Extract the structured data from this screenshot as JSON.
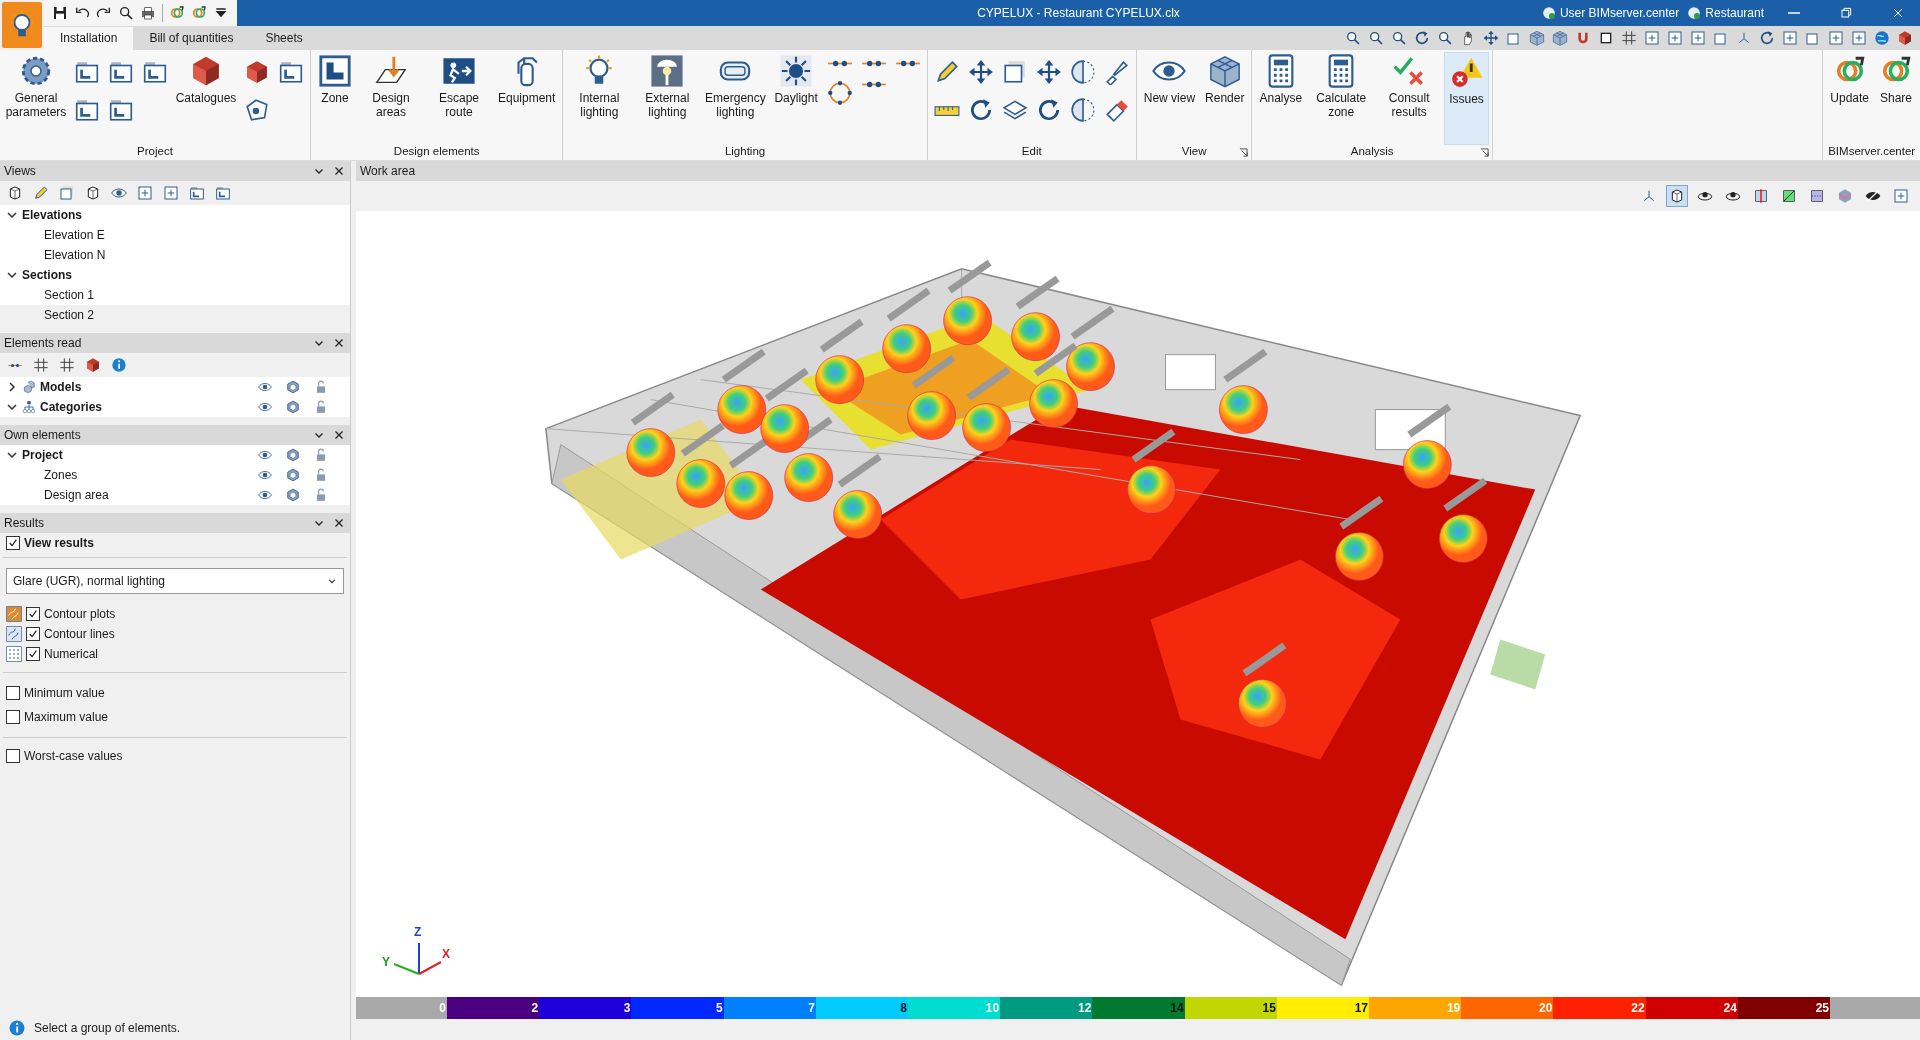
{
  "window": {
    "title": "CYPELUX - Restaurant CYPELUX.clx",
    "user": "User BIMserver.center",
    "project": "Restaurant"
  },
  "tabs": [
    {
      "label": "Installation",
      "selected": true
    },
    {
      "label": "Bill of quantities",
      "selected": false
    },
    {
      "label": "Sheets",
      "selected": false
    }
  ],
  "ribbon": [
    {
      "label": "Project",
      "dialog_launcher": false,
      "items": [
        {
          "kind": "large",
          "label": "General parameters",
          "highlighted": false
        },
        {
          "kind": "stack"
        },
        {
          "kind": "stack"
        },
        {
          "kind": "stack"
        },
        {
          "kind": "large",
          "label": "Catalogues",
          "highlighted": false
        },
        {
          "kind": "stack"
        },
        {
          "kind": "stack"
        }
      ]
    },
    {
      "label": "Design elements",
      "dialog_launcher": false,
      "items": [
        {
          "kind": "large",
          "label": "Zone",
          "highlighted": false
        },
        {
          "kind": "large",
          "label": "Design areas",
          "highlighted": false
        },
        {
          "kind": "large",
          "label": "Escape route",
          "highlighted": false
        },
        {
          "kind": "large",
          "label": "Equipment",
          "highlighted": false
        }
      ]
    },
    {
      "label": "Lighting",
      "dialog_launcher": false,
      "items": [
        {
          "kind": "large",
          "label": "Internal lighting",
          "highlighted": false
        },
        {
          "kind": "large",
          "label": "External lighting",
          "highlighted": false
        },
        {
          "kind": "large",
          "label": "Emergency lighting",
          "highlighted": false
        },
        {
          "kind": "large",
          "label": "Daylight",
          "highlighted": false
        },
        {
          "kind": "stack"
        },
        {
          "kind": "stack"
        },
        {
          "kind": "stack"
        }
      ]
    },
    {
      "label": "Edit",
      "dialog_launcher": false,
      "items": [
        {
          "kind": "stack"
        },
        {
          "kind": "stack"
        },
        {
          "kind": "stack"
        },
        {
          "kind": "stack"
        },
        {
          "kind": "stack"
        },
        {
          "kind": "stack"
        }
      ]
    },
    {
      "label": "View",
      "dialog_launcher": true,
      "items": [
        {
          "kind": "large",
          "label": "New view",
          "highlighted": false
        },
        {
          "kind": "large",
          "label": "Render",
          "highlighted": false
        }
      ]
    },
    {
      "label": "Analysis",
      "dialog_launcher": true,
      "items": [
        {
          "kind": "large",
          "label": "Analyse",
          "highlighted": false
        },
        {
          "kind": "large",
          "label": "Calculate zone",
          "highlighted": false
        },
        {
          "kind": "large",
          "label": "Consult results",
          "highlighted": false
        },
        {
          "kind": "large",
          "label": "Issues",
          "highlighted": true
        }
      ]
    },
    {
      "label": "BIMserver.center",
      "dialog_launcher": false,
      "items": [
        {
          "kind": "large",
          "label": "Update",
          "highlighted": false
        },
        {
          "kind": "large",
          "label": "Share",
          "highlighted": false
        }
      ]
    }
  ],
  "views_panel": {
    "title": "Views",
    "tree": [
      {
        "label": "Elevations",
        "expanded": true,
        "selected": false,
        "children": [
          {
            "label": "Elevation E",
            "selected": false
          },
          {
            "label": "Elevation N",
            "selected": false
          }
        ]
      },
      {
        "label": "Sections",
        "expanded": true,
        "selected": false,
        "children": [
          {
            "label": "Section 1",
            "selected": false
          },
          {
            "label": "Section 2",
            "selected": true
          }
        ]
      }
    ]
  },
  "elements_read_panel": {
    "title": "Elements read",
    "tree": [
      {
        "label": "Models",
        "expanded": false
      },
      {
        "label": "Categories",
        "expanded": true
      }
    ]
  },
  "own_elements_panel": {
    "title": "Own elements",
    "tree": [
      {
        "label": "Project",
        "expanded": true,
        "children": [
          {
            "label": "Zones"
          },
          {
            "label": "Design area"
          }
        ]
      }
    ]
  },
  "results_panel": {
    "title": "Results",
    "view_results": {
      "label": "View results",
      "checked": true
    },
    "result_type": {
      "value": "Glare (UGR), normal lighting"
    },
    "display_options": [
      {
        "label": "Contour plots",
        "checked": true
      },
      {
        "label": "Contour lines",
        "checked": true
      },
      {
        "label": "Numerical",
        "checked": true
      }
    ],
    "value_options": [
      {
        "label": "Minimum value",
        "checked": false
      },
      {
        "label": "Maximum value",
        "checked": false
      }
    ],
    "worst_case": {
      "label": "Worst-case values",
      "checked": false
    }
  },
  "status_bar": {
    "message": "Select a group of elements."
  },
  "work_area": {
    "title": "Work area",
    "view_toolbar": [
      {
        "selected": false
      },
      {
        "selected": true
      },
      {
        "selected": false
      },
      {
        "selected": false
      },
      {
        "selected": false
      },
      {
        "selected": false
      },
      {
        "selected": false
      },
      {
        "selected": false
      },
      {
        "selected": false
      },
      {
        "selected": false
      }
    ],
    "axis_labels": [
      "X",
      "Y",
      "Z"
    ],
    "color_scale": {
      "start_label": "0",
      "bands": [
        {
          "color": "#4b0080",
          "label": "2"
        },
        {
          "color": "#1e00d8",
          "label": "3"
        },
        {
          "color": "#0028ff",
          "label": "5"
        },
        {
          "color": "#0080ff",
          "label": "7"
        },
        {
          "color": "#00ccff",
          "label": "8"
        },
        {
          "color": "#00dcd0",
          "label": "10"
        },
        {
          "color": "#009a80",
          "label": "12"
        },
        {
          "color": "#007a30",
          "label": "14"
        },
        {
          "color": "#c0d800",
          "label": "15"
        },
        {
          "color": "#ffee00",
          "label": "17"
        },
        {
          "color": "#ffa500",
          "label": "19"
        },
        {
          "color": "#ff6600",
          "label": "20"
        },
        {
          "color": "#ff2000",
          "label": "22"
        },
        {
          "color": "#d00000",
          "label": "24"
        },
        {
          "color": "#800000",
          "label": "25"
        }
      ]
    }
  }
}
